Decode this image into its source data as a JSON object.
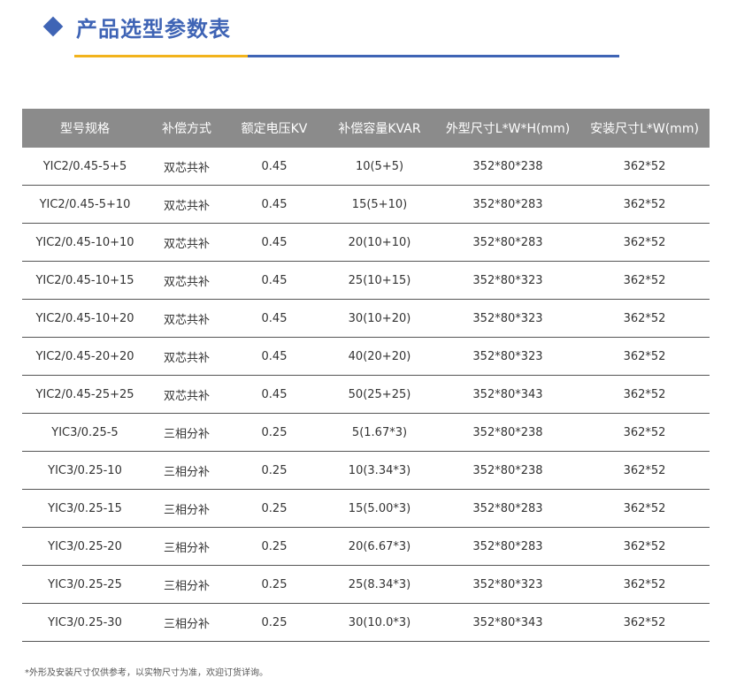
{
  "header": {
    "title": "产品选型参数表",
    "icon": "diamond-icon",
    "accent_color": "#3f64b5",
    "underline_accent": "#f2b31c"
  },
  "table": {
    "columns": [
      "型号规格",
      "补偿方式",
      "额定电压KV",
      "补偿容量KVAR",
      "外型尺寸L*W*H(mm)",
      "安装尺寸L*W(mm)"
    ],
    "rows": [
      [
        "YIC2/0.45-5+5",
        "双芯共补",
        "0.45",
        "10(5+5)",
        "352*80*238",
        "362*52"
      ],
      [
        "YIC2/0.45-5+10",
        "双芯共补",
        "0.45",
        "15(5+10)",
        "352*80*283",
        "362*52"
      ],
      [
        "YIC2/0.45-10+10",
        "双芯共补",
        "0.45",
        "20(10+10)",
        "352*80*283",
        "362*52"
      ],
      [
        "YIC2/0.45-10+15",
        "双芯共补",
        "0.45",
        "25(10+15)",
        "352*80*323",
        "362*52"
      ],
      [
        "YIC2/0.45-10+20",
        "双芯共补",
        "0.45",
        "30(10+20)",
        "352*80*323",
        "362*52"
      ],
      [
        "YIC2/0.45-20+20",
        "双芯共补",
        "0.45",
        "40(20+20)",
        "352*80*323",
        "362*52"
      ],
      [
        "YIC2/0.45-25+25",
        "双芯共补",
        "0.45",
        "50(25+25)",
        "352*80*343",
        "362*52"
      ],
      [
        "YIC3/0.25-5",
        "三相分补",
        "0.25",
        "5(1.67*3)",
        "352*80*238",
        "362*52"
      ],
      [
        "YIC3/0.25-10",
        "三相分补",
        "0.25",
        "10(3.34*3)",
        "352*80*238",
        "362*52"
      ],
      [
        "YIC3/0.25-15",
        "三相分补",
        "0.25",
        "15(5.00*3)",
        "352*80*283",
        "362*52"
      ],
      [
        "YIC3/0.25-20",
        "三相分补",
        "0.25",
        "20(6.67*3)",
        "352*80*283",
        "362*52"
      ],
      [
        "YIC3/0.25-25",
        "三相分补",
        "0.25",
        "25(8.34*3)",
        "352*80*323",
        "362*52"
      ],
      [
        "YIC3/0.25-30",
        "三相分补",
        "0.25",
        "30(10.0*3)",
        "352*80*343",
        "362*52"
      ]
    ]
  },
  "footnote": "*外形及安装尺寸仅供参考，以实物尺寸为准，欢迎订货详询。"
}
